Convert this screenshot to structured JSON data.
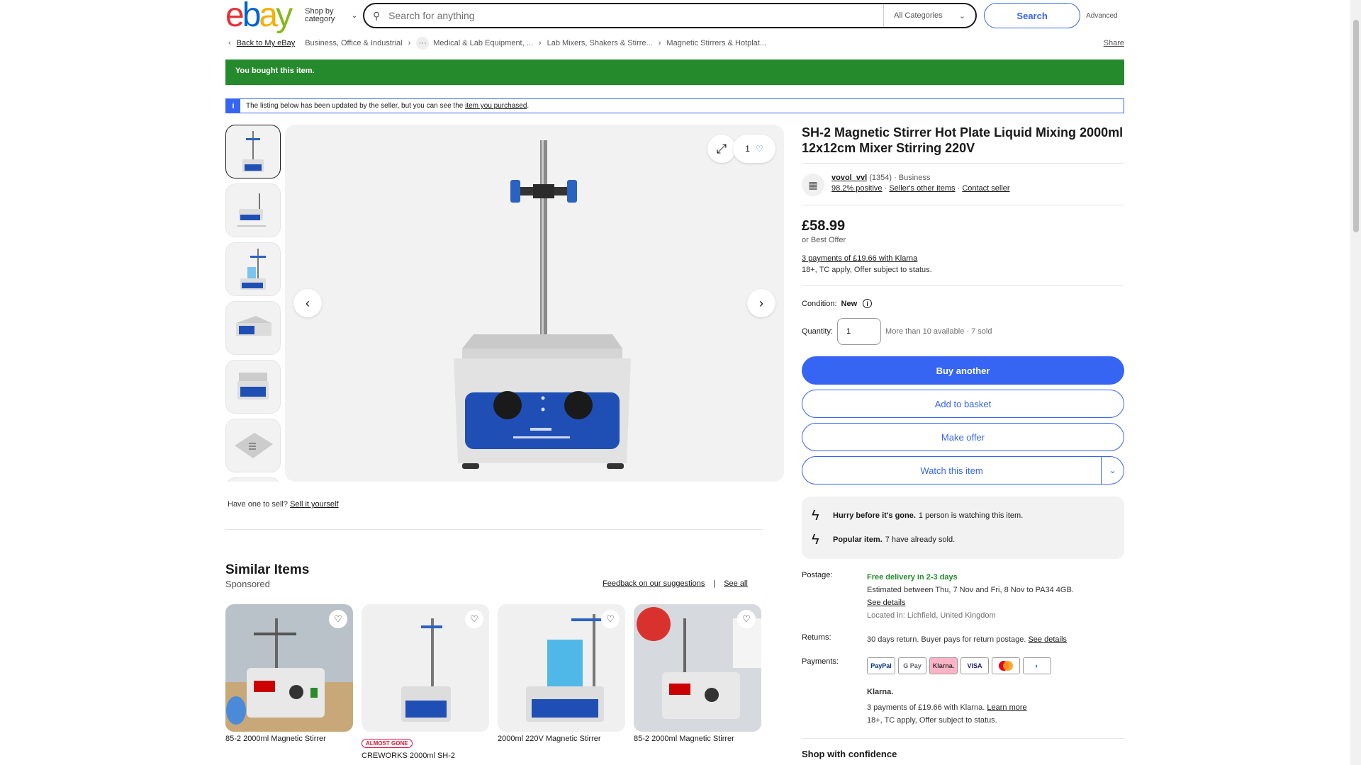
{
  "header": {
    "logo": [
      "e",
      "b",
      "a",
      "y"
    ],
    "shop_by": "Shop by category",
    "search_placeholder": "Search for anything",
    "category": "All Categories",
    "search_btn": "Search",
    "advanced": "Advanced"
  },
  "breadcrumb": {
    "back": "Back to My eBay",
    "items": [
      "Business, Office & Industrial",
      "Medical & Lab Equipment, ...",
      "Lab Mixers, Shakers & Stirre...",
      "Magnetic Stirrers & Hotplat..."
    ],
    "share": "Share"
  },
  "bought": "You bought this item.",
  "info": {
    "text": "The listing below has been updated by the seller, but you can see the",
    "link": "item you purchased",
    "end": "."
  },
  "gallery": {
    "fav_count": "1"
  },
  "have_one": {
    "text": "Have one to sell?",
    "link": "Sell it yourself"
  },
  "item": {
    "title": "SH-2 Magnetic Stirrer Hot Plate Liquid Mixing 2000ml 12x12cm Mixer Stirring 220V",
    "seller_name": "vovol_vvl",
    "seller_count": "(1354)",
    "seller_type": "· Business",
    "positive": "98.2% positive",
    "other_items": "Seller's other items",
    "contact": "Contact seller",
    "price": "£58.99",
    "best_offer": "or Best Offer",
    "klarna": "3 payments of £19.66 with Klarna",
    "tc": "18+, TC apply, Offer subject to status.",
    "condition_label": "Condition:",
    "condition": "New",
    "qty_label": "Quantity:",
    "qty": "1",
    "avail": "More than 10 available · 7 sold",
    "buy": "Buy another",
    "basket": "Add to basket",
    "offer": "Make offer",
    "watch": "Watch this item",
    "hurry_bold": "Hurry before it's gone.",
    "hurry_text": "1 person is watching this item.",
    "popular_bold": "Popular item.",
    "popular_text": "7 have already sold."
  },
  "details": {
    "postage_label": "Postage:",
    "free": "Free delivery in 2-3 days",
    "estimated": "Estimated between Thu, 7 Nov and Fri, 8 Nov to PA34 4GB.",
    "see_details": "See details",
    "located": "Located in: Lichfield, United Kingdom",
    "returns_label": "Returns:",
    "returns": "30 days return. Buyer pays for return postage.",
    "returns_link": "See details",
    "payments_label": "Payments:",
    "payments": [
      "PayPal",
      "G Pay",
      "Klarna.",
      "VISA",
      "MC",
      "D"
    ],
    "klarna_title": "Klarna.",
    "klarna_text": "3 payments of £19.66 with Klarna.",
    "learn_more": "Learn more",
    "klarna_tc": "18+, TC apply, Offer subject to status.",
    "shop_conf": "Shop with confidence"
  },
  "similar": {
    "title": "Similar Items",
    "sponsored": "Sponsored",
    "feedback": "Feedback on our suggestions",
    "see_all": "See all",
    "cards": [
      {
        "title": "85-2 2000ml Magnetic Stirrer",
        "badge": ""
      },
      {
        "title": "CREWORKS 2000ml SH-2",
        "badge": "ALMOST GONE"
      },
      {
        "title": "2000ml 220V Magnetic Stirrer",
        "badge": ""
      },
      {
        "title": "85-2 2000ml Magnetic Stirrer",
        "badge": ""
      }
    ]
  },
  "colors": {
    "accent": "#3665f3",
    "success": "#258a2c"
  }
}
